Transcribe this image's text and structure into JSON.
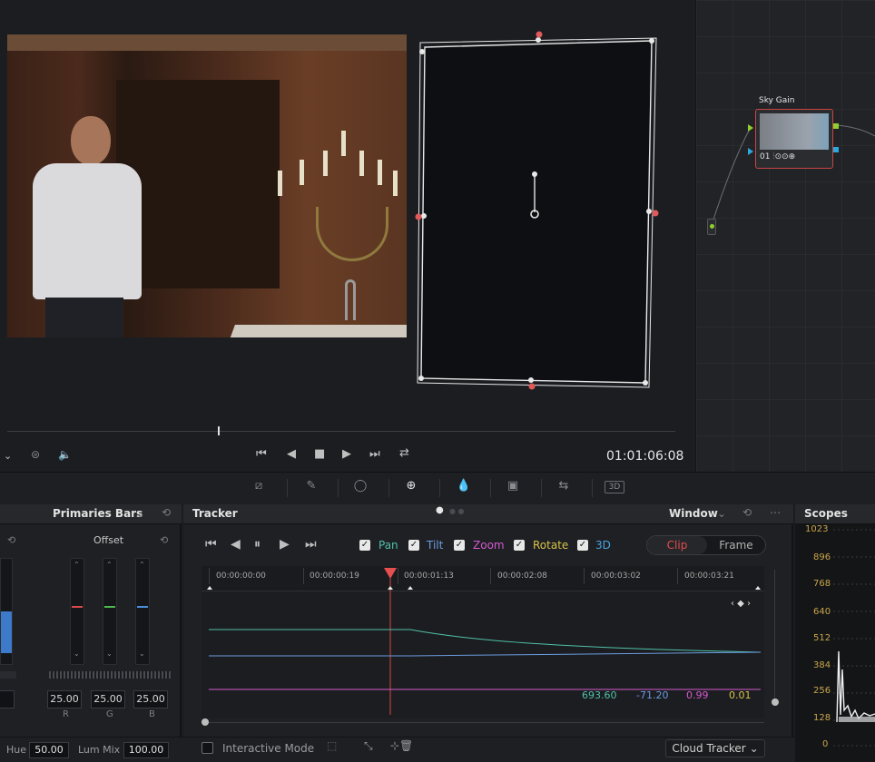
{
  "viewer": {
    "timecode": "01:01:06:08",
    "controls": [
      "prev-clip",
      "step-back",
      "stop",
      "play",
      "next-clip",
      "loop"
    ]
  },
  "node_editor": {
    "node_label": "Sky Gain",
    "node_number": "01"
  },
  "primaries": {
    "title": "Primaries Bars",
    "wheel_label": "Offset",
    "values": {
      "left_partial": "0",
      "r": "25.00",
      "g": "25.00",
      "b": "25.00"
    },
    "channel_labels": [
      "R",
      "G",
      "B"
    ],
    "colors": {
      "r": "#d94a4a",
      "g": "#4fb84f",
      "b": "#4a8fd9"
    }
  },
  "tracker": {
    "title": "Tracker",
    "mode_menu": "Window",
    "controls": [
      "first-frame",
      "track-back",
      "pause",
      "track-forward",
      "last-frame"
    ],
    "checkboxes": [
      {
        "label": "Pan",
        "checked": true,
        "color": "#4fc1a9"
      },
      {
        "label": "Tilt",
        "checked": true,
        "color": "#6a9ce0"
      },
      {
        "label": "Zoom",
        "checked": true,
        "color": "#d55ad0"
      },
      {
        "label": "Rotate",
        "checked": true,
        "color": "#d8c44a"
      },
      {
        "label": "3D",
        "checked": true,
        "color": "#4aa4e0"
      }
    ],
    "segment": {
      "clip": "Clip",
      "frame": "Frame",
      "active": "Clip"
    },
    "ruler_ticks": [
      "00:00:00:00",
      "00:00:00:19",
      "00:00:01:13",
      "00:00:02:08",
      "00:00:03:02",
      "00:00:03:21"
    ],
    "readouts": [
      {
        "value": "693.60",
        "color": "#4fc1a9"
      },
      {
        "value": "-71.20",
        "color": "#6a9ce0"
      },
      {
        "value": "0.99",
        "color": "#d55ad0"
      },
      {
        "value": "0.01",
        "color": "#d8c44a"
      }
    ],
    "interactive_mode_label": "Interactive Mode",
    "cloud_tracker_label": "Cloud Tracker"
  },
  "footer": {
    "hue_label": "Hue",
    "hue_value": "50.00",
    "lum_mix_label": "Lum Mix",
    "lum_mix_value": "100.00"
  },
  "scopes": {
    "title": "Scopes",
    "scale": [
      "1023",
      "896",
      "768",
      "640",
      "512",
      "384",
      "256",
      "128",
      "0"
    ]
  }
}
